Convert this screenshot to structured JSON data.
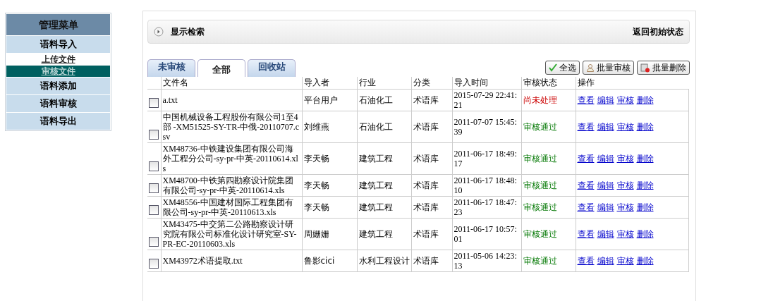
{
  "sidebar": {
    "title": "管理菜单",
    "items": [
      {
        "label": "语料导入",
        "kind": "group",
        "selected": false
      },
      {
        "label": "上传文件",
        "kind": "subitem",
        "selected": false
      },
      {
        "label": "审核文件",
        "kind": "subitem",
        "selected": true
      },
      {
        "label": "语料添加",
        "kind": "group",
        "selected": false
      },
      {
        "label": "语料审核",
        "kind": "group",
        "selected": false
      },
      {
        "label": "语料导出",
        "kind": "group",
        "selected": false
      }
    ]
  },
  "search_bar": {
    "title": "显示检索",
    "reset_link": "返回初始状态"
  },
  "tabs": [
    {
      "label": "未审核",
      "selected": false
    },
    {
      "label": "全部",
      "selected": true
    },
    {
      "label": "回收站",
      "selected": false
    }
  ],
  "toolbar_buttons": [
    {
      "label": "全选",
      "kind": "check"
    },
    {
      "label": "批量审核",
      "kind": "user"
    },
    {
      "label": "批量删除",
      "kind": "delete"
    }
  ],
  "table": {
    "columns": [
      "文件名",
      "导入者",
      "行业",
      "分类",
      "导入时间",
      "审核状态",
      "操作"
    ],
    "rows": [
      {
        "checked": false,
        "file": "a.txt",
        "importer": "平台用户",
        "industry": "石油化工",
        "category": "术语库",
        "time": "2015-07-29 22:41:21",
        "status": "尚未处理",
        "kind": "pending",
        "actions": [
          "查看",
          "编辑",
          "审核",
          "删除"
        ]
      },
      {
        "checked": false,
        "file": "中国机械设备工程股份有限公司1至4部 -XM51525-SY-TR-中俄-20110707.csv",
        "importer": "刘维燕",
        "industry": "石油化工",
        "category": "术语库",
        "time": "2011-07-07 15:45:39",
        "status": "审核通过",
        "kind": "approved",
        "actions": [
          "查看",
          "编辑",
          "审核",
          "删除"
        ]
      },
      {
        "checked": false,
        "file": "XM48736-中铁建设集团有限公司海外工程分公司-sy-pr-中英-20110614.xls",
        "importer": "李天畅",
        "industry": "建筑工程",
        "category": "术语库",
        "time": "2011-06-17 18:49:17",
        "status": "审核通过",
        "kind": "approved",
        "actions": [
          "查看",
          "编辑",
          "审核",
          "删除"
        ]
      },
      {
        "checked": false,
        "file": "XM48700-中铁第四勘察设计院集团有限公司-sy-pr-中英-20110614.xls",
        "importer": "李天畅",
        "industry": "建筑工程",
        "category": "术语库",
        "time": "2011-06-17 18:48:10",
        "status": "审核通过",
        "kind": "approved",
        "actions": [
          "查看",
          "编辑",
          "审核",
          "删除"
        ]
      },
      {
        "checked": false,
        "file": "XM48556-中国建材国际工程集团有限公司-sy-pr-中英-20110613.xls",
        "importer": "李天畅",
        "industry": "建筑工程",
        "category": "术语库",
        "time": "2011-06-17 18:47:23",
        "status": "审核通过",
        "kind": "approved",
        "actions": [
          "查看",
          "编辑",
          "审核",
          "删除"
        ]
      },
      {
        "checked": false,
        "file": "XM43475-中交第二公路勘察设计研究院有限公司标准化设计研究室-SY-PR-EC-20110603.xls",
        "importer": "周姗姗",
        "industry": "建筑工程",
        "category": "术语库",
        "time": "2011-06-17 10:57:01",
        "status": "审核通过",
        "kind": "approved",
        "actions": [
          "查看",
          "编辑",
          "审核",
          "删除"
        ]
      },
      {
        "checked": false,
        "file": "XM43972术语提取.txt",
        "importer": "鲁影cici",
        "industry": "水利工程设计",
        "category": "术语库",
        "time": "2011-05-06 14:23:13",
        "status": "审核通过",
        "kind": "approved",
        "actions": [
          "查看",
          "编辑",
          "审核",
          "删除"
        ]
      }
    ]
  }
}
